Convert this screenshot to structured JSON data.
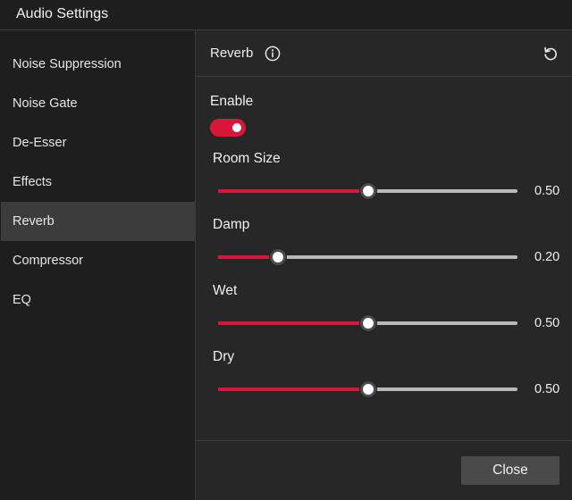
{
  "window": {
    "title": "Audio Settings"
  },
  "sidebar": {
    "items": [
      {
        "label": "Noise Suppression",
        "active": false
      },
      {
        "label": "Noise Gate",
        "active": false
      },
      {
        "label": "De-Esser",
        "active": false
      },
      {
        "label": "Effects",
        "active": false
      },
      {
        "label": "Reverb",
        "active": true
      },
      {
        "label": "Compressor",
        "active": false
      },
      {
        "label": "EQ",
        "active": false
      }
    ]
  },
  "panel": {
    "title": "Reverb",
    "info_icon": "info-icon",
    "reset_icon": "reset-icon",
    "enable": {
      "label": "Enable",
      "on": true
    },
    "sliders": [
      {
        "label": "Room Size",
        "value": 0.5,
        "value_text": "0.50"
      },
      {
        "label": "Damp",
        "value": 0.2,
        "value_text": "0.20"
      },
      {
        "label": "Wet",
        "value": 0.5,
        "value_text": "0.50"
      },
      {
        "label": "Dry",
        "value": 0.5,
        "value_text": "0.50"
      }
    ]
  },
  "footer": {
    "close_label": "Close"
  },
  "colors": {
    "accent": "#d8173a",
    "track": "#b9b9b9",
    "active_item": "#3c3c3c"
  }
}
